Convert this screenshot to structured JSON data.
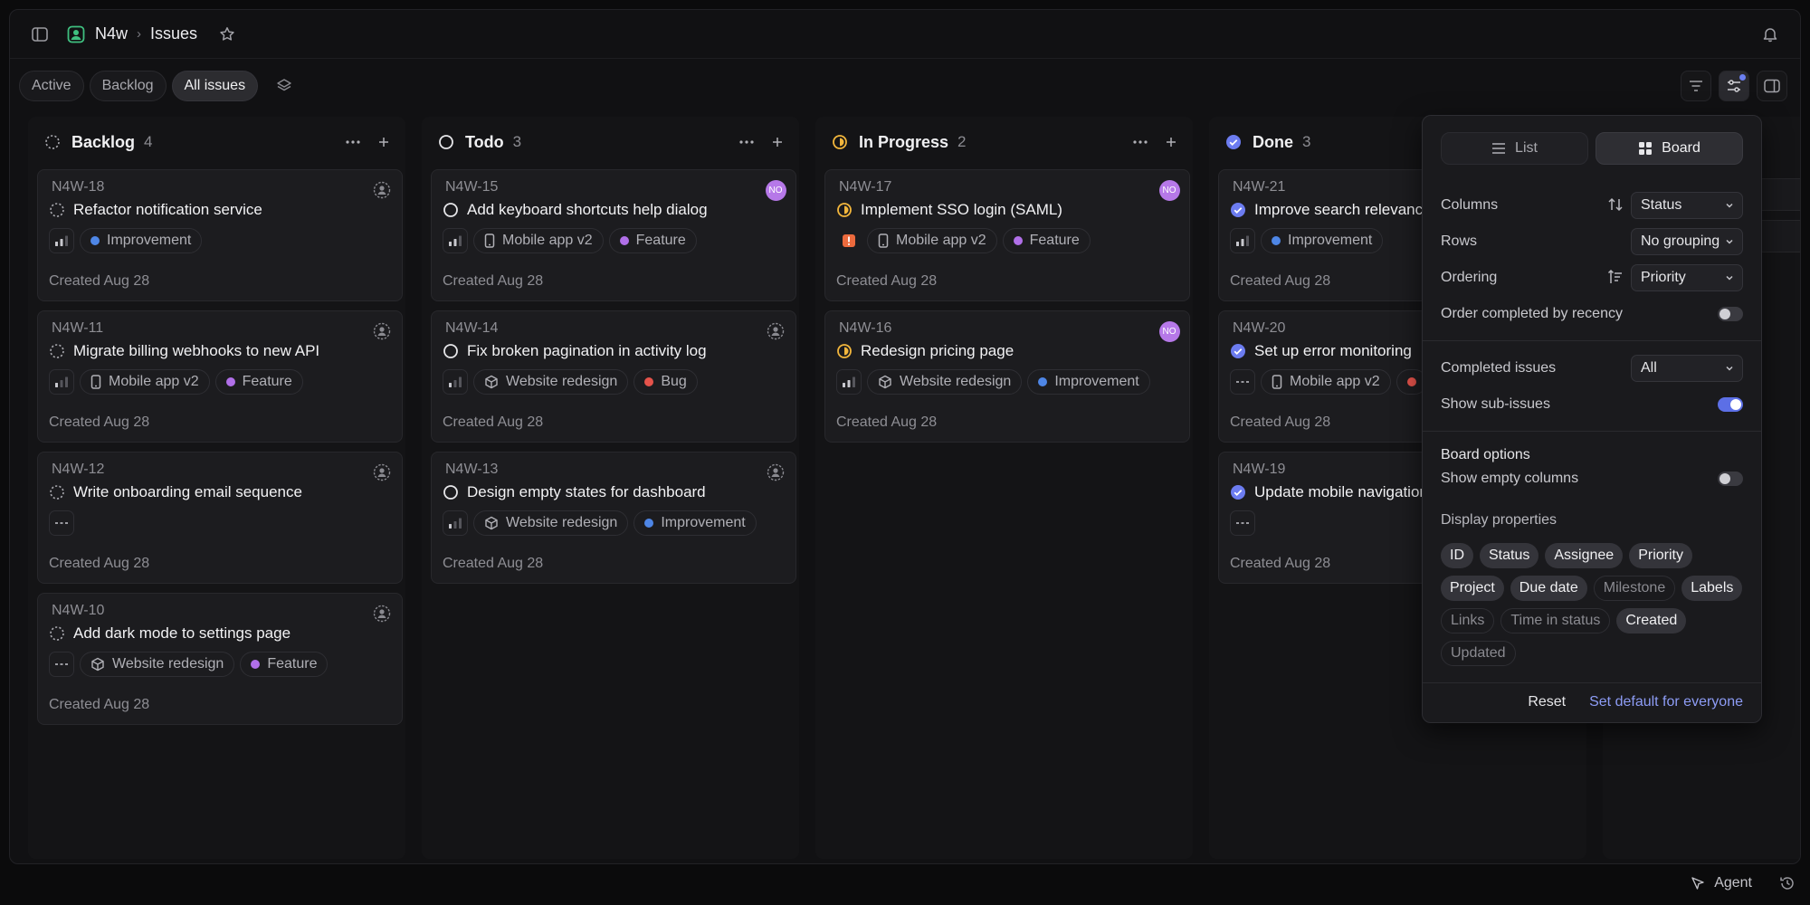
{
  "header": {
    "team": "N4w",
    "page": "Issues"
  },
  "views": [
    {
      "label": "Active",
      "active": false
    },
    {
      "label": "Backlog",
      "active": false
    },
    {
      "label": "All issues",
      "active": true
    }
  ],
  "columns": [
    {
      "title": "Backlog",
      "count": "4",
      "status": "backlog",
      "cards": [
        {
          "id": "N4W-18",
          "title": "Refactor notification service",
          "priority": "medium",
          "project": "",
          "label": "Improvement",
          "label_color": "#4e86e6",
          "created": "Created Aug 28",
          "assignee": "none"
        },
        {
          "id": "N4W-11",
          "title": "Migrate billing webhooks to new API",
          "priority": "low",
          "project": "Mobile app v2",
          "project_icon": "mobile",
          "label": "Feature",
          "label_color": "#b06fe8",
          "created": "Created Aug 28",
          "assignee": "none"
        },
        {
          "id": "N4W-12",
          "title": "Write onboarding email sequence",
          "priority": "nopriority",
          "project": "",
          "label": "",
          "created": "Created Aug 28",
          "assignee": "none"
        },
        {
          "id": "N4W-10",
          "title": "Add dark mode to settings page",
          "priority": "nopriority",
          "project": "Website redesign",
          "project_icon": "cube",
          "label": "Feature",
          "label_color": "#b06fe8",
          "created": "Created Aug 28",
          "assignee": "none"
        }
      ]
    },
    {
      "title": "Todo",
      "count": "3",
      "status": "todo",
      "cards": [
        {
          "id": "N4W-15",
          "title": "Add keyboard shortcuts help dialog",
          "priority": "medium",
          "project": "Mobile app v2",
          "project_icon": "mobile",
          "label": "Feature",
          "label_color": "#b06fe8",
          "created": "Created Aug 28",
          "assignee": "NO"
        },
        {
          "id": "N4W-14",
          "title": "Fix broken pagination in activity log",
          "priority": "low",
          "project": "Website redesign",
          "project_icon": "cube",
          "label": "Bug",
          "label_color": "#e5534b",
          "created": "Created Aug 28",
          "assignee": "none"
        },
        {
          "id": "N4W-13",
          "title": "Design empty states for dashboard",
          "priority": "low",
          "project": "Website redesign",
          "project_icon": "cube",
          "label": "Improvement",
          "label_color": "#4e86e6",
          "created": "Created Aug 28",
          "assignee": "none"
        }
      ]
    },
    {
      "title": "In Progress",
      "count": "2",
      "status": "inprogress",
      "cards": [
        {
          "id": "N4W-17",
          "title": "Implement SSO login (SAML)",
          "priority": "urgent",
          "project": "Mobile app v2",
          "project_icon": "mobile",
          "label": "Feature",
          "label_color": "#b06fe8",
          "created": "Created Aug 28",
          "assignee": "NO"
        },
        {
          "id": "N4W-16",
          "title": "Redesign pricing page",
          "priority": "medium",
          "project": "Website redesign",
          "project_icon": "cube",
          "label": "Improvement",
          "label_color": "#4e86e6",
          "created": "Created Aug 28",
          "assignee": "NO"
        }
      ]
    },
    {
      "title": "Done",
      "count": "3",
      "status": "done",
      "cards": [
        {
          "id": "N4W-21",
          "title": "Improve search relevance",
          "priority": "medium",
          "project": "",
          "label": "Improvement",
          "label_color": "#4e86e6",
          "created": "Created Aug 28",
          "assignee": "none"
        },
        {
          "id": "N4W-20",
          "title": "Set up error monitoring",
          "priority": "nopriority",
          "project": "Mobile app v2",
          "project_icon": "mobile",
          "label": "",
          "label_color": "#e5534b",
          "created": "Created Aug 28",
          "assignee": "none"
        },
        {
          "id": "N4W-19",
          "title": "Update mobile navigation",
          "priority": "nopriority",
          "project": "",
          "label": "",
          "created": "Created Aug 28",
          "assignee": "none"
        }
      ]
    }
  ],
  "panel": {
    "list_label": "List",
    "board_label": "Board",
    "columns_label": "Columns",
    "columns_value": "Status",
    "rows_label": "Rows",
    "rows_value": "No grouping",
    "ordering_label": "Ordering",
    "ordering_value": "Priority",
    "order_completed_label": "Order completed by recency",
    "completed_label": "Completed issues",
    "completed_value": "All",
    "subissues_label": "Show sub-issues",
    "board_options_label": "Board options",
    "empty_columns_label": "Show empty columns",
    "display_properties_label": "Display properties",
    "properties": [
      {
        "label": "ID",
        "on": true
      },
      {
        "label": "Status",
        "on": true
      },
      {
        "label": "Assignee",
        "on": true
      },
      {
        "label": "Priority",
        "on": true
      },
      {
        "label": "Project",
        "on": true
      },
      {
        "label": "Due date",
        "on": true
      },
      {
        "label": "Milestone",
        "on": false
      },
      {
        "label": "Labels",
        "on": true
      },
      {
        "label": "Links",
        "on": false
      },
      {
        "label": "Time in status",
        "on": false
      },
      {
        "label": "Created",
        "on": true
      },
      {
        "label": "Updated",
        "on": false
      }
    ],
    "reset_label": "Reset",
    "set_default_label": "Set default for everyone"
  },
  "footer": {
    "agent_label": "Agent"
  },
  "colors": {
    "accent": "#5c6fe6",
    "in_progress": "#f2b63c",
    "done": "#6c7cf0",
    "urgent": "#ec6a3d"
  }
}
